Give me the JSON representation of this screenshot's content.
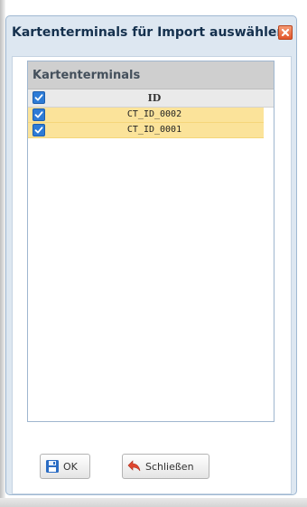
{
  "dialog": {
    "title": "Kartenterminals für Import auswählen",
    "close_icon": "close-icon"
  },
  "grid": {
    "title": "Kartenterminals",
    "column_header": "ID",
    "select_all_checked": true,
    "rows": [
      {
        "id": "CT_ID_0002",
        "checked": true
      },
      {
        "id": "CT_ID_0001",
        "checked": true
      }
    ]
  },
  "buttons": {
    "ok_label": "OK",
    "ok_icon": "save-icon",
    "close_label": "Schließen",
    "close_icon": "undo-icon"
  },
  "colors": {
    "dialog_bg": "#dde7f1",
    "title_text": "#15314e",
    "close_button": "#e2562b",
    "header_bg": "#cfcfcf",
    "selected_row": "#fbe39a",
    "checkbox": "#2d7bd6"
  }
}
